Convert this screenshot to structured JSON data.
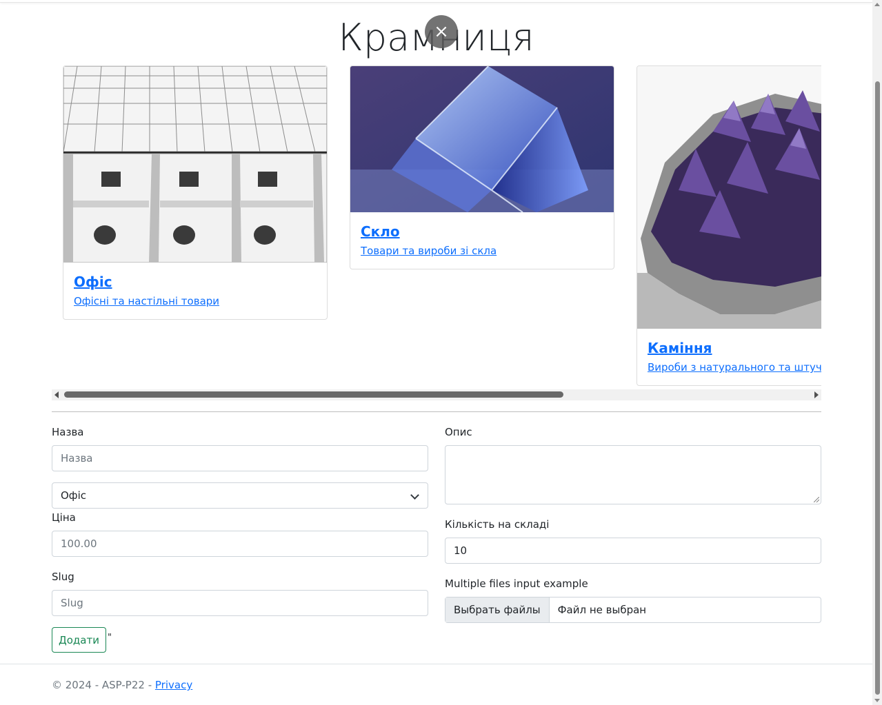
{
  "page": {
    "title": "Крамниця"
  },
  "overlay": {
    "close_symbol": "×",
    "close_icon": "close-icon"
  },
  "carousel": {
    "cards": [
      {
        "title": "Офіс",
        "description": "Офісні та настільні товари",
        "image": "office-cubicles-image"
      },
      {
        "title": "Скло",
        "description": "Товари та вироби зі скла",
        "image": "glass-cube-image"
      },
      {
        "title": "Каміння",
        "description": "Вироби з натурального та штучного",
        "image": "amethyst-stone-image"
      }
    ],
    "scroll_position": 0
  },
  "form": {
    "name_label": "Назва",
    "name_placeholder": "Назва",
    "category_selected": "Офіс",
    "price_label": "Ціна",
    "price_placeholder": "100.00",
    "slug_label": "Slug",
    "slug_placeholder": "Slug",
    "submit_label": "Додати",
    "stray_mark": "\"",
    "description_label": "Опис",
    "stock_label": "Кількість на складі",
    "stock_value": "10",
    "files_label": "Multiple files input example",
    "files_button": "Выбрать файлы",
    "files_status": "Файл не выбран"
  },
  "footer": {
    "copyright": "© 2024 - ASP-P22 - ",
    "privacy_link": "Privacy"
  },
  "colors": {
    "link": "#0d6efd",
    "success": "#198754",
    "muted": "#6c757d"
  }
}
